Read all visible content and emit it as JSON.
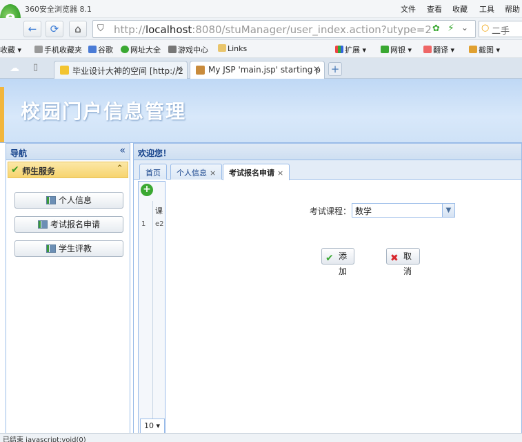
{
  "browser": {
    "title": "360安全浏览器 8.1",
    "menus": [
      "文件",
      "查看",
      "收藏",
      "工具",
      "帮助"
    ],
    "address": {
      "host": "localhost",
      "prefix": "http://",
      "rest": ":8080/stuManager/user_index.action?utype=2"
    },
    "search_text": "二手",
    "bookmarks": [
      "收藏",
      "手机收藏夹",
      "谷歌",
      "网址大全",
      "游戏中心",
      "Links",
      "扩展",
      "网银",
      "翻译",
      "截图"
    ],
    "tabs": [
      {
        "label": "毕业设计大神的空间 [http://2",
        "active": false
      },
      {
        "label": "My JSP 'main.jsp' starting p",
        "active": true
      }
    ],
    "status_text": "已结束 javascript:void(0)"
  },
  "header": {
    "title": "校园门户信息管理"
  },
  "nav": {
    "title": "导航",
    "collapse_icon": "«",
    "section": "师生服务",
    "items": [
      "个人信息",
      "考试报名申请",
      "学生评教"
    ]
  },
  "main": {
    "title": "欢迎您！",
    "tabs": [
      {
        "label": "首页",
        "closable": false
      },
      {
        "label": "个人信息",
        "closable": true
      },
      {
        "label": "考试报名申请",
        "closable": true,
        "active": true
      }
    ],
    "grid": {
      "column": "课",
      "row_number": "1",
      "cell": "e2",
      "page_size": "10"
    },
    "form": {
      "course_label": "考试课程：",
      "course_value": "数学",
      "add_label": "添加",
      "cancel_label": "取消"
    }
  }
}
